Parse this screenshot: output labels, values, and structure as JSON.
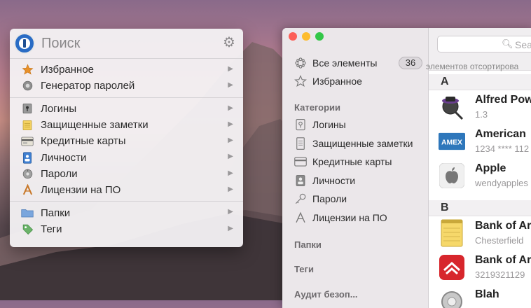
{
  "mini": {
    "search_placeholder": "Поиск",
    "groups": [
      [
        {
          "label": "Избранное",
          "icon": "star-icon"
        },
        {
          "label": "Генератор паролей",
          "icon": "gear-generator-icon"
        }
      ],
      [
        {
          "label": "Логины",
          "icon": "login-icon"
        },
        {
          "label": "Защищенные заметки",
          "icon": "note-icon"
        },
        {
          "label": "Кредитные карты",
          "icon": "credit-card-icon"
        },
        {
          "label": "Личности",
          "icon": "identity-icon"
        },
        {
          "label": "Пароли",
          "icon": "password-icon"
        },
        {
          "label": "Лицензии на ПО",
          "icon": "software-license-icon"
        }
      ],
      [
        {
          "label": "Папки",
          "icon": "folder-icon"
        },
        {
          "label": "Теги",
          "icon": "tag-icon"
        }
      ]
    ]
  },
  "sidebar": {
    "all_items": "Все элементы",
    "all_count": "36",
    "favorites": "Избранное",
    "categories_header": "Категории",
    "categories": [
      "Логины",
      "Защищенные заметки",
      "Кредитные карты",
      "Личности",
      "Пароли",
      "Лицензии на ПО"
    ],
    "folders_header": "Папки",
    "tags_header": "Теги",
    "audit_header": "Аудит безоп..."
  },
  "list": {
    "search_placeholder": "Searc",
    "sort_text": "элементов отсортирова",
    "sections": [
      {
        "letter": "A",
        "items": [
          {
            "title": "Alfred Pow",
            "subtitle": "1.3"
          },
          {
            "title": "American",
            "subtitle": "1234 **** 112"
          },
          {
            "title": "Apple",
            "subtitle": "wendyapples"
          }
        ]
      },
      {
        "letter": "B",
        "items": [
          {
            "title": "Bank of Ar",
            "subtitle": "Chesterfield"
          },
          {
            "title": "Bank of Ar",
            "subtitle": "3219321129"
          },
          {
            "title": "Blah",
            "subtitle": ""
          }
        ]
      }
    ]
  },
  "colors": {
    "close": "#fc5f57",
    "minimize": "#fdbc2e",
    "zoom": "#33c748",
    "accent": "#2a6cc5"
  }
}
